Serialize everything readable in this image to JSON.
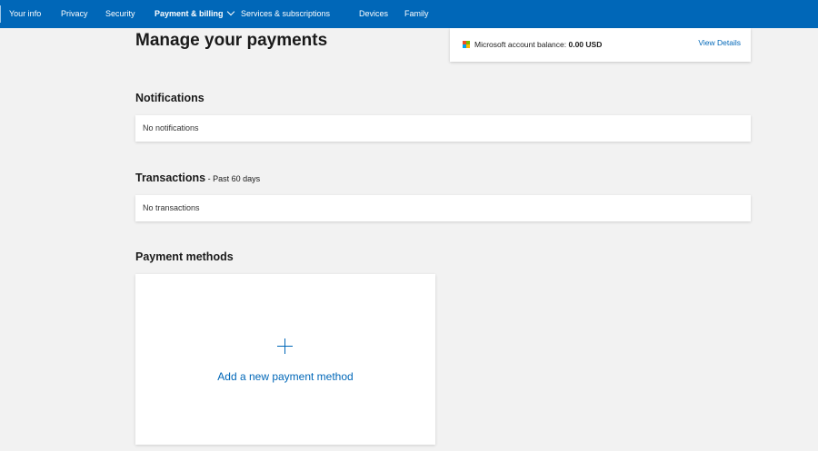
{
  "nav": {
    "items": [
      {
        "label": "Your info"
      },
      {
        "label": "Privacy"
      },
      {
        "label": "Security"
      },
      {
        "label": "Payment & billing"
      },
      {
        "label": "Services & subscriptions"
      },
      {
        "label": "Devices"
      },
      {
        "label": "Family"
      }
    ]
  },
  "page": {
    "title": "Manage your payments"
  },
  "balance": {
    "label": "Microsoft account balance:",
    "value": "0.00 USD",
    "link": "View Details"
  },
  "notifications": {
    "title": "Notifications",
    "empty": "No notifications"
  },
  "transactions": {
    "title": "Transactions",
    "subtitle": " - Past 60 days",
    "empty": "No transactions"
  },
  "payment_methods": {
    "title": "Payment methods",
    "add_label": "Add a new payment method"
  },
  "colors": {
    "accent": "#0067b8",
    "logo": [
      "#f25022",
      "#7fba00",
      "#00a4ef",
      "#ffb900"
    ]
  }
}
